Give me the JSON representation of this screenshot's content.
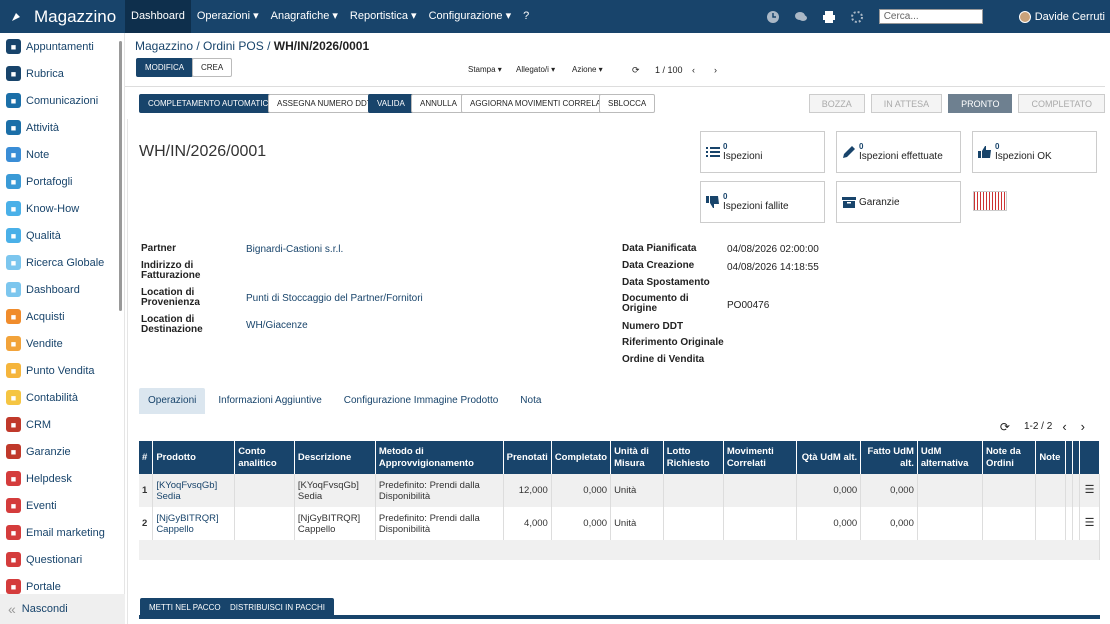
{
  "app": {
    "title": "Magazzino",
    "menu": [
      "Dashboard",
      "Operazioni ▾",
      "Anagrafiche ▾",
      "Reportistica ▾",
      "Configurazione ▾",
      "?"
    ],
    "search_placeholder": "Cerca...",
    "user": "Davide Cerruti"
  },
  "sidebar": {
    "items": [
      {
        "label": "Appuntamenti",
        "color": "#18446b",
        "icon": "calendar-icon"
      },
      {
        "label": "Rubrica",
        "color": "#18446b",
        "icon": "contacts-icon"
      },
      {
        "label": "Comunicazioni",
        "color": "#1b6fa8",
        "icon": "chat-icon"
      },
      {
        "label": "Attività",
        "color": "#1b6fa8",
        "icon": "check-icon"
      },
      {
        "label": "Note",
        "color": "#3a8dd6",
        "icon": "note-icon"
      },
      {
        "label": "Portafogli",
        "color": "#3a9ad6",
        "icon": "lock-icon"
      },
      {
        "label": "Know-How",
        "color": "#4ab0e8",
        "icon": "bulb-icon"
      },
      {
        "label": "Qualità",
        "color": "#4ab0e8",
        "icon": "quality-icon"
      },
      {
        "label": "Ricerca Globale",
        "color": "#7cc6ee",
        "icon": "search-icon"
      },
      {
        "label": "Dashboard",
        "color": "#7cc6ee",
        "icon": "dashboard-icon"
      },
      {
        "label": "Acquisti",
        "color": "#f08c2c",
        "icon": "cart-icon"
      },
      {
        "label": "Vendite",
        "color": "#f2a33a",
        "icon": "chart-icon"
      },
      {
        "label": "Punto Vendita",
        "color": "#f5b53c",
        "icon": "pos-icon"
      },
      {
        "label": "Contabilità",
        "color": "#f5c542",
        "icon": "accounting-icon"
      },
      {
        "label": "CRM",
        "color": "#c0392b",
        "icon": "crm-icon"
      },
      {
        "label": "Garanzie",
        "color": "#c0392b",
        "icon": "shield-icon"
      },
      {
        "label": "Helpdesk",
        "color": "#d43c3c",
        "icon": "headset-icon"
      },
      {
        "label": "Eventi",
        "color": "#d43c3c",
        "icon": "event-icon"
      },
      {
        "label": "Email marketing",
        "color": "#d43c3c",
        "icon": "email-icon"
      },
      {
        "label": "Questionari",
        "color": "#d43c3c",
        "icon": "survey-icon"
      },
      {
        "label": "Portale",
        "color": "#d43c3c",
        "icon": "portal-icon"
      }
    ],
    "hide_label": "Nascondi"
  },
  "breadcrumb": {
    "part1": "Magazzino",
    "part2": "Ordini POS",
    "current": "WH/IN/2026/0001"
  },
  "toolbar": {
    "edit": "MODIFICA",
    "create": "CREA",
    "print": "Stampa ▾",
    "attach": "Allegato/i ▾",
    "action": "Azione ▾",
    "pager": "1 / 100"
  },
  "actions": [
    "COMPLETAMENTO AUTOMATICO",
    "ASSEGNA NUMERO DDT",
    "VALIDA",
    "ANNULLA",
    "AGGIORNA MOVIMENTI CORRELATI",
    "SBLOCCA"
  ],
  "status": [
    "BOZZA",
    "IN ATTESA",
    "PRONTO",
    "COMPLETATO"
  ],
  "doc_title": "WH/IN/2026/0001",
  "stats": [
    {
      "count": "0",
      "label": "Ispezioni"
    },
    {
      "count": "0",
      "label": "Ispezioni effettuate"
    },
    {
      "count": "0",
      "label": "Ispezioni OK"
    },
    {
      "count": "0",
      "label": "Ispezioni fallite"
    },
    {
      "count": "",
      "label": "Garanzie"
    }
  ],
  "fields_left": [
    {
      "label": "Partner",
      "value": "Bignardi-Castioni s.r.l."
    },
    {
      "label": "Indirizzo di Fatturazione",
      "value": ""
    },
    {
      "label": "Location di Provenienza",
      "value": "Punti di Stoccaggio del Partner/Fornitori"
    },
    {
      "label": "Location di Destinazione",
      "value": "WH/Giacenze"
    }
  ],
  "fields_right": [
    {
      "label": "Data Pianificata",
      "value": "04/08/2026 02:00:00"
    },
    {
      "label": "Data Creazione",
      "value": "04/08/2026 14:18:55"
    },
    {
      "label": "Data Spostamento",
      "value": ""
    },
    {
      "label": "Documento di Origine",
      "value": "PO00476"
    },
    {
      "label": "Numero DDT",
      "value": ""
    },
    {
      "label": "Riferimento Originale",
      "value": ""
    },
    {
      "label": "Ordine di Vendita",
      "value": ""
    }
  ],
  "tabs": [
    "Operazioni",
    "Informazioni Aggiuntive",
    "Configurazione Immagine Prodotto",
    "Nota"
  ],
  "table": {
    "pager": "1-2 / 2",
    "headers": [
      "#",
      "Prodotto",
      "Conto analitico",
      "Descrizione",
      "Metodo di Approvvigionamento",
      "Prenotati",
      "Completato",
      "Unità di Misura",
      "Lotto Richiesto",
      "Movimenti Correlati",
      "Qtà UdM alt.",
      "Fatto UdM alt.",
      "UdM alternativa",
      "Note da Ordini",
      "Note"
    ],
    "rows": [
      {
        "n": "1",
        "code": "[KYoqFvsqGb]",
        "name": "Sedia",
        "conto": "",
        "desc1": "[KYoqFvsqGb]",
        "desc2": "Sedia",
        "metodo": "Predefinito: Prendi dalla Disponibilità",
        "prenotati": "12,000",
        "completato": "0,000",
        "udm": "Unità",
        "qta_alt": "0,000",
        "fatto_alt": "0,000"
      },
      {
        "n": "2",
        "code": "[NjGyBITRQR]",
        "name": "Cappello",
        "conto": "",
        "desc1": "[NjGyBITRQR]",
        "desc2": "Cappello",
        "metodo": "Predefinito: Prendi dalla Disponibilità",
        "prenotati": "4,000",
        "completato": "0,000",
        "udm": "Unità",
        "qta_alt": "0,000",
        "fatto_alt": "0,000"
      }
    ]
  },
  "footer_buttons": [
    "METTI NEL PACCO",
    "DISTRIBUISCI IN PACCHI"
  ]
}
